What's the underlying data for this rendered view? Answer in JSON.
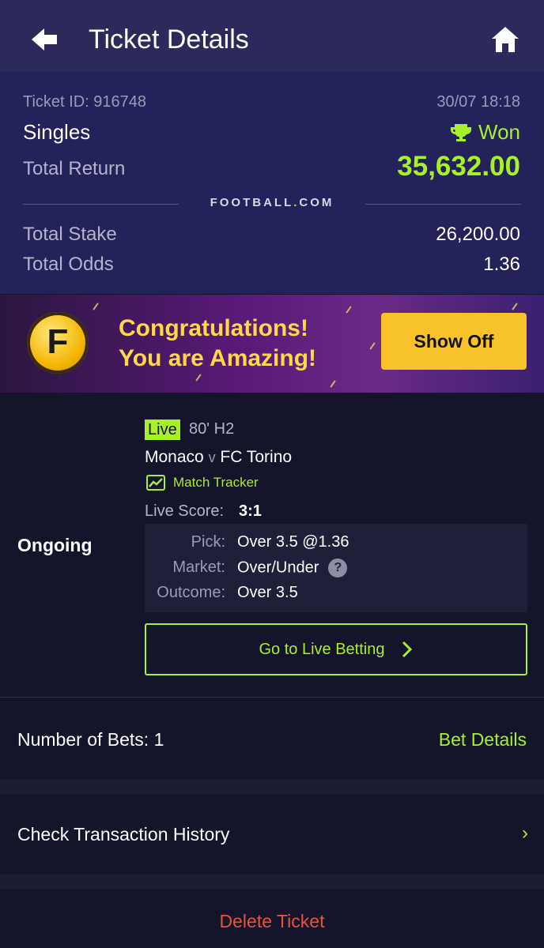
{
  "header": {
    "title": "Ticket Details",
    "back_icon": "arrow-left-icon",
    "home_icon": "home-icon"
  },
  "summary": {
    "ticket_id": "Ticket ID: 916748",
    "date": "30/07 18:18",
    "bet_type": "Singles",
    "status": "Won",
    "total_return_label": "Total Return",
    "total_return_value": "35,632.00",
    "brand_text": "FOOTBALL",
    "brand_dot": ".",
    "brand_suffix": "COM",
    "total_stake_label": "Total Stake",
    "total_stake_value": "26,200.00",
    "total_odds_label": "Total Odds",
    "total_odds_value": "1.36"
  },
  "banner": {
    "coin_letter": "F",
    "line1": "Congratulations!",
    "line2": "You are Amazing!",
    "button": "Show Off"
  },
  "bet": {
    "state": "Ongoing",
    "live_badge": "Live",
    "minute": "80' H2",
    "home_team": "Monaco",
    "vs": "v",
    "away_team": "FC Torino",
    "tracker_label": "Match Tracker",
    "live_score_label": "Live Score:",
    "live_score_value": "3:1",
    "pick_label": "Pick:",
    "pick_value": "Over 3.5 @1.36",
    "market_label": "Market:",
    "market_value": "Over/Under",
    "help_glyph": "?",
    "outcome_label": "Outcome:",
    "outcome_value": "Over 3.5",
    "go_live_label": "Go to Live Betting"
  },
  "footer": {
    "num_bets_label": "Number of Bets: 1",
    "bet_details_link": "Bet Details",
    "tx_history_label": "Check Transaction History",
    "tx_arrow": "›",
    "delete_label": "Delete Ticket"
  },
  "colors": {
    "accent": "#a8f02a",
    "header_bg": "#2b2a5a",
    "summary_bg": "#23225a",
    "danger": "#f0503a",
    "gold": "#f8c22a"
  }
}
